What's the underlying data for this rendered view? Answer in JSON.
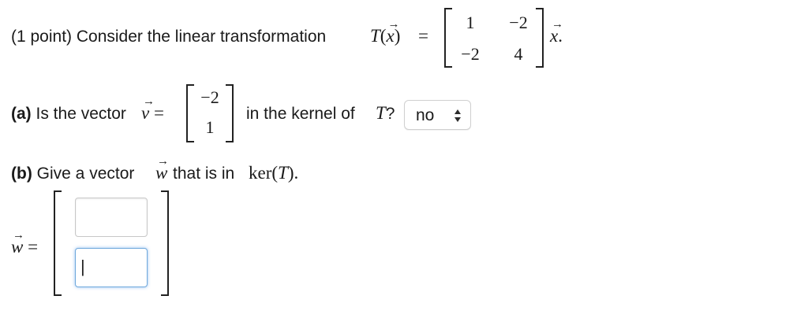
{
  "question": {
    "intro": "(1 point) Consider the linear transformation",
    "T_symbol": "T",
    "x_symbol": "x",
    "equals": "=",
    "matrix": [
      [
        "1",
        "−2"
      ],
      [
        "−2",
        "4"
      ]
    ],
    "period": "."
  },
  "part_a": {
    "label": "(a)",
    "text_before": "Is the vector",
    "v_symbol": "v",
    "vector": [
      "−2",
      "1"
    ],
    "text_after": "in the kernel of",
    "T_symbol": "T",
    "question_mark": "?",
    "select_value": "no"
  },
  "part_b": {
    "label": "(b)",
    "text_before": "Give a vector",
    "w_symbol": "w",
    "text_after": "that is in",
    "ker_text": "ker(",
    "T_symbol": "T",
    "close": ").",
    "answer_symbol": "w",
    "answer_equals": "=",
    "entries": [
      "",
      "|"
    ]
  }
}
